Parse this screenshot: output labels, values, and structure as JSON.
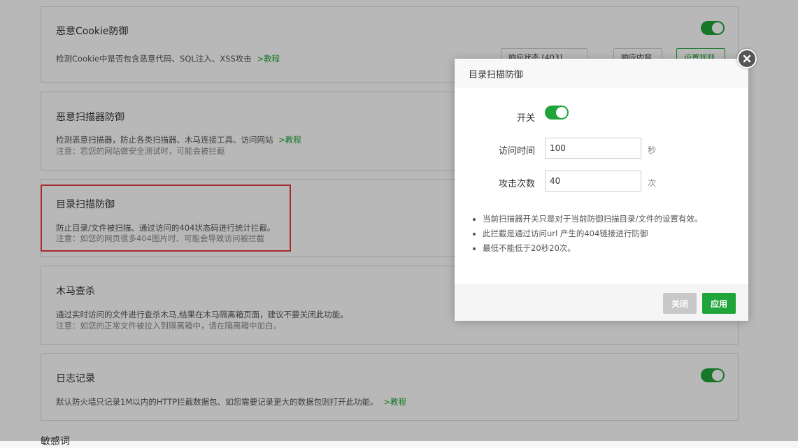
{
  "cards": [
    {
      "title": "恶意Cookie防御",
      "desc": "检测Cookie中是否包含恶意代码、SQL注入、XSS攻击",
      "tutorial": ">教程",
      "note": "",
      "toggle_on": true,
      "controls": [
        "响应状态 [403]",
        "响应内容",
        "设置规则"
      ]
    },
    {
      "title": "恶意扫描器防御",
      "desc": "检测恶意扫描器，防止各类扫描器、木马连接工具、访问网站",
      "tutorial": ">教程",
      "note": "注意：若您的网站做安全测试时，可能会被拦截"
    },
    {
      "title": "目录扫描防御",
      "desc": "防止目录/文件被扫描、通过访问的404状态码进行统计拦截。",
      "tutorial": "",
      "note": "注意：如您的网页很多404图片时、可能会导致访问被拦截"
    },
    {
      "title": "木马查杀",
      "desc": "通过实时访问的文件进行查杀木马,结果在木马隔离箱页面，建议不要关闭此功能。",
      "tutorial": "",
      "note": "注意：如您的正常文件被拉入到隔离箱中，请在隔离箱中加白。"
    },
    {
      "title": "日志记录",
      "desc": "默认防火墙只记录1M以内的HTTP拦截数据包、如您需要记录更大的数据包则打开此功能。",
      "tutorial": ">教程",
      "note": "",
      "toggle_on": true
    }
  ],
  "partial_next_title": "敏感词",
  "modal": {
    "title": "目录扫描防御",
    "switch_label": "开关",
    "switch_on": true,
    "visit_time_label": "访问时间",
    "visit_time_value": "100",
    "visit_time_unit": "秒",
    "attack_count_label": "攻击次数",
    "attack_count_value": "40",
    "attack_count_unit": "次",
    "notes": [
      "当前扫描器开关只是对于当前防御扫描目录/文件的设置有效。",
      "此拦截是通过访问url 产生的404链接进行防御",
      "最低不能低于20秒20次。"
    ],
    "close_label": "关闭",
    "apply_label": "应用"
  },
  "colors": {
    "accent": "#20a53a",
    "highlight": "#e53e3e"
  }
}
